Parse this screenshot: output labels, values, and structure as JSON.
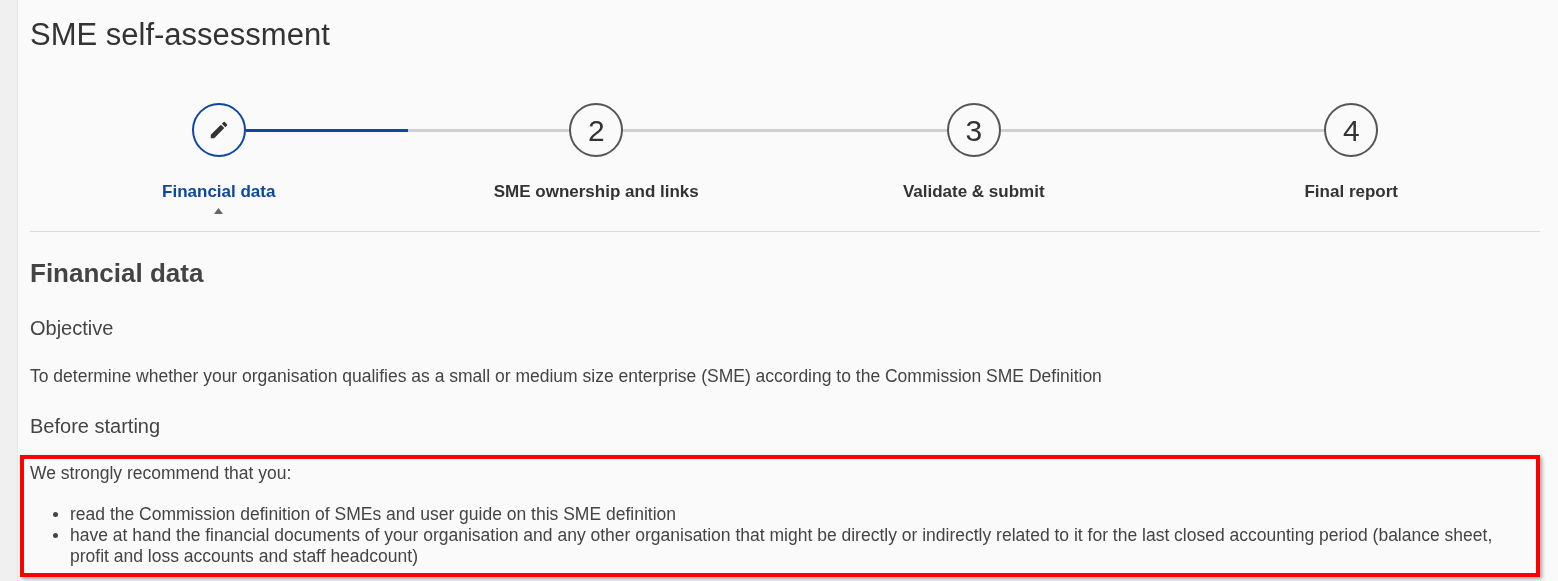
{
  "page_title": "SME self-assessment",
  "steps": [
    {
      "kind": "icon",
      "label": "Financial data",
      "selected": true
    },
    {
      "kind": "number",
      "number": "2",
      "label": "SME ownership and links",
      "selected": false
    },
    {
      "kind": "number",
      "number": "3",
      "label": "Validate & submit",
      "selected": false
    },
    {
      "kind": "number",
      "number": "4",
      "label": "Final report",
      "selected": false
    }
  ],
  "section_title": "Financial data",
  "objective": {
    "heading": "Objective",
    "text": "To determine whether your organisation qualifies as a small or medium size enterprise (SME) according to the Commission SME Definition"
  },
  "before_starting": {
    "heading": "Before starting",
    "intro": "We strongly recommend that you:",
    "items": [
      "read the Commission definition of SMEs and user guide on this SME definition",
      "have at hand the financial documents of your organisation and any other organisation that might be directly or indirectly related to it for the last closed accounting period (balance sheet, profit and loss accounts and staff headcount)"
    ]
  }
}
